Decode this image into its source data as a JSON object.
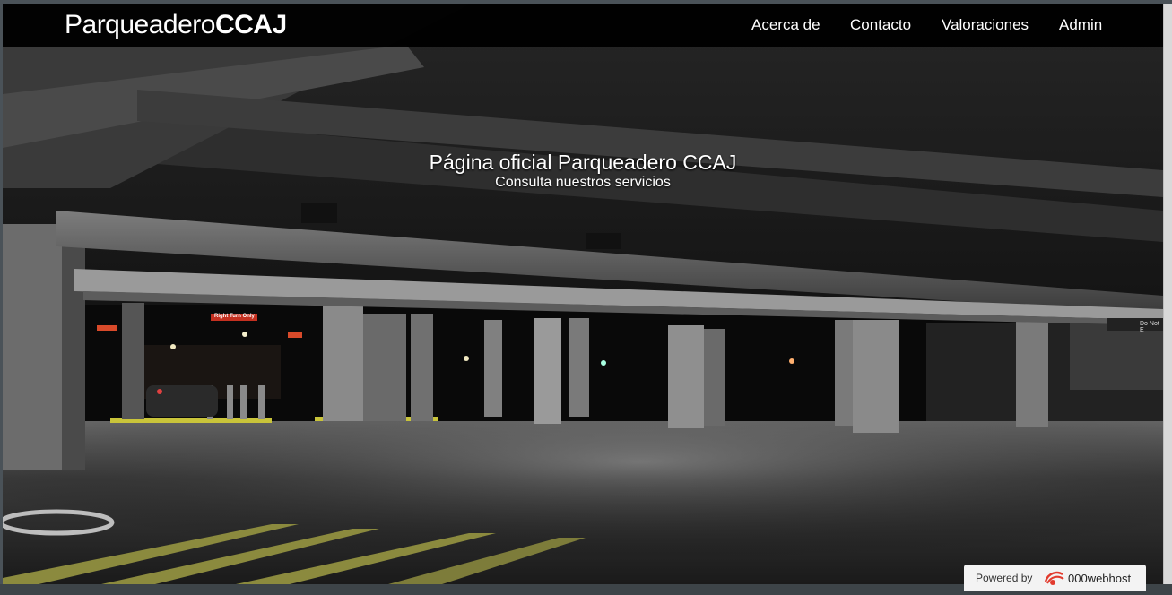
{
  "navbar": {
    "brand_light": "Parqueadero",
    "brand_bold": "CCAJ",
    "links": [
      "Acerca de",
      "Contacto",
      "Valoraciones",
      "Admin"
    ]
  },
  "hero": {
    "title": "Página oficial Parqueadero CCAJ",
    "subtitle": "Consulta nuestros servicios",
    "signs": [
      "Right Turn Only",
      "Do Not E"
    ]
  },
  "badge": {
    "powered": "Powered by",
    "brand": "000webhost"
  },
  "colors": {
    "navbar": "#000000",
    "text": "#ffffff",
    "curb_yellow": "#c9c43a"
  }
}
